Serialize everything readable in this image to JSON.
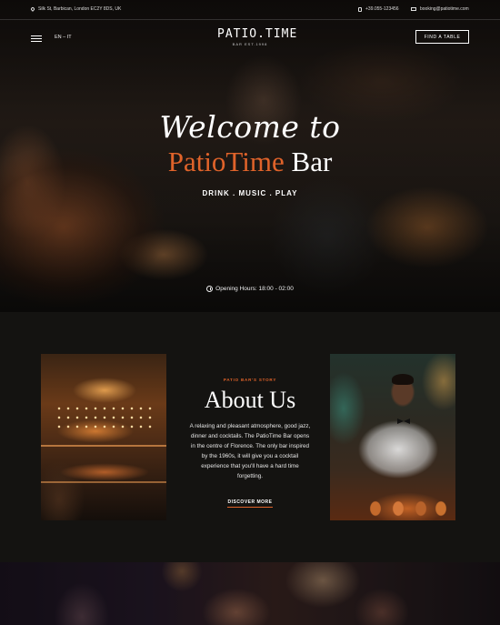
{
  "topbar": {
    "address": "Silk St, Barbican, London EC2Y 8DS, UK",
    "phone": "+39.055-123456",
    "email": "booking@patiotime.com"
  },
  "nav": {
    "language": "EN – IT",
    "logo_name": "PATIO.TIME",
    "logo_sub": "BAR EST.1998",
    "cta_label": "FIND A TABLE"
  },
  "hero": {
    "welcome": "Welcome to",
    "brand_accent": "PatioTime",
    "brand_rest": " Bar",
    "tagline": "DRINK . MUSIC . PLAY",
    "hours": "Opening Hours: 18:00 - 02:00"
  },
  "about": {
    "eyebrow": "PATIO BAR'S STORY",
    "title": "About Us",
    "body": "A relaxing and pleasant atmosphere, good jazz, dinner and cocktails. The PatioTime Bar opens in the centre of Florence. The only bar inspired by the 1960s, it will give you a cocktail experience that you'll have a hard time forgetting.",
    "link_label": "DISCOVER MORE"
  },
  "colors": {
    "accent": "#e0632a",
    "background": "#151412"
  }
}
